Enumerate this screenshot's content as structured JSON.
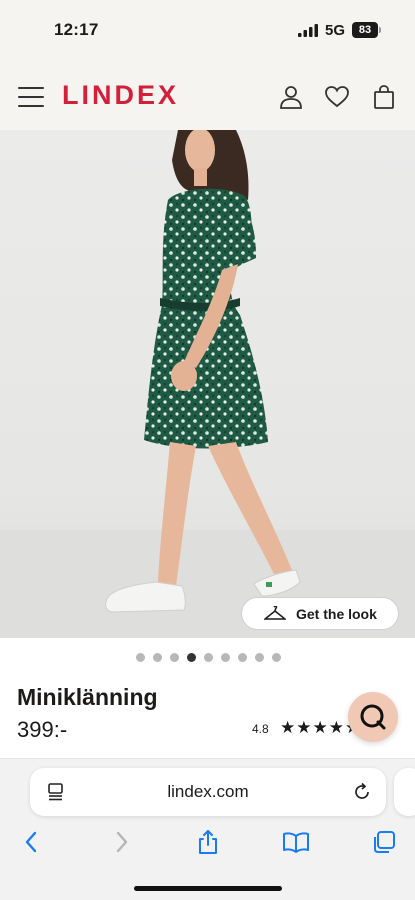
{
  "status_bar": {
    "time": "12:17",
    "network": "5G",
    "battery": "83"
  },
  "header": {
    "logo": "LINDEX"
  },
  "hero": {
    "get_the_look_label": "Get the look",
    "image_count": 9,
    "active_index": 3
  },
  "product": {
    "name": "Miniklänning",
    "price": "399:-",
    "rating": "4.8",
    "stars": 5
  },
  "browser": {
    "url": "lindex.com"
  },
  "colors": {
    "brand": "#d31f3a",
    "chat_button": "#f0c8b4",
    "ios_blue": "#1a7cf5"
  }
}
